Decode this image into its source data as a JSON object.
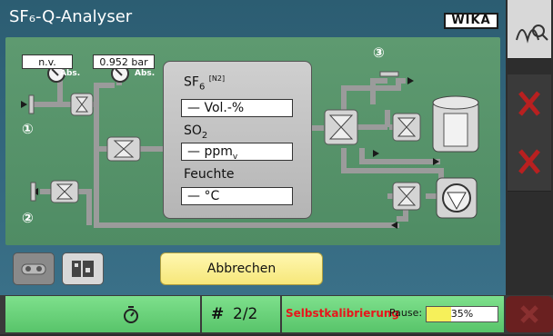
{
  "app": {
    "title": "SF₆-Q-Analyser",
    "brand": "WIKA"
  },
  "gauges": {
    "left": {
      "value": "n.v.",
      "unit_label": "Abs."
    },
    "right": {
      "value": "0.952 bar",
      "unit_label": "Abs."
    }
  },
  "ports": {
    "p1": "①",
    "p2": "②",
    "p3": "③"
  },
  "measurements": {
    "sf6": {
      "label_main": "SF",
      "label_sub": "6",
      "label_sup": "[N2]",
      "value": "— Vol.-%"
    },
    "so2": {
      "label_main": "SO",
      "label_sub": "2",
      "value_main": "— ppm",
      "value_sub": "v"
    },
    "humidity": {
      "label": "Feuchte",
      "value": "— °C"
    }
  },
  "buttons": {
    "cancel": "Abbrechen"
  },
  "status": {
    "timer_icon": "stopwatch-icon",
    "count_symbol": "#",
    "count_value": "2/2",
    "calibration_label": "Selbstkalibrierung",
    "pause_label": "Pause:",
    "progress_text": "35%",
    "progress_fraction": 0.35
  },
  "colors": {
    "accent_red": "#e8151b",
    "status_green": "#6ad47a",
    "pipe_gray": "#9b9b9b"
  }
}
